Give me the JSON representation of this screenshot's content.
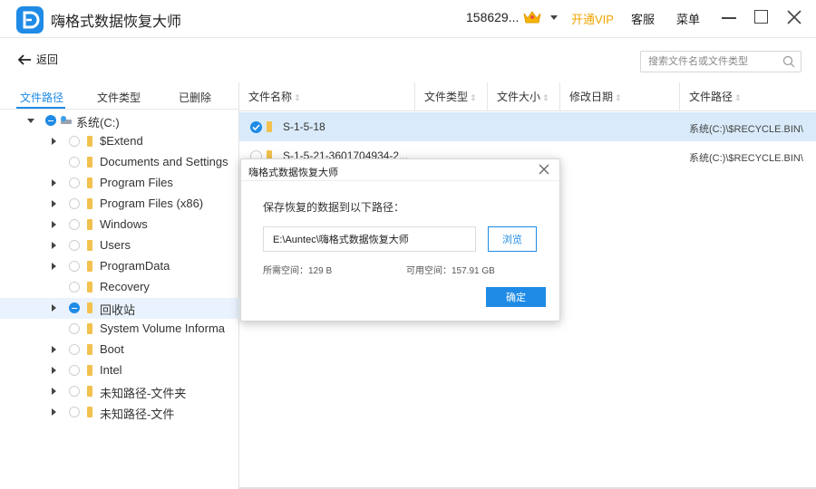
{
  "app": {
    "title": "嗨格式数据恢复大师",
    "user_id": "158629...",
    "vip_label": "开通VIP",
    "service_label": "客服",
    "menu_label": "菜单",
    "accent_color": "#1f8be6",
    "vip_color": "#f0a400"
  },
  "toolbar": {
    "back_label": "返回",
    "search_placeholder": "搜索文件名或文件类型"
  },
  "left_tabs": [
    {
      "label": "文件路径",
      "active": true
    },
    {
      "label": "文件类型",
      "active": false
    },
    {
      "label": "已删除",
      "active": false
    }
  ],
  "tree": {
    "root": {
      "label": "系统(C:)",
      "expanded": true,
      "check": "partial"
    },
    "items": [
      {
        "label": "$Extend",
        "has_children": true,
        "check": "off"
      },
      {
        "label": "Documents and Settings",
        "has_children": false,
        "check": "off"
      },
      {
        "label": "Program Files",
        "has_children": true,
        "check": "off"
      },
      {
        "label": "Program Files (x86)",
        "has_children": true,
        "check": "off"
      },
      {
        "label": "Windows",
        "has_children": true,
        "check": "off"
      },
      {
        "label": "Users",
        "has_children": true,
        "check": "off"
      },
      {
        "label": "ProgramData",
        "has_children": true,
        "check": "off"
      },
      {
        "label": "Recovery",
        "has_children": false,
        "check": "off"
      },
      {
        "label": "回收站",
        "has_children": true,
        "check": "partial",
        "selected": true
      },
      {
        "label": "System Volume Informa",
        "has_children": false,
        "check": "off"
      },
      {
        "label": "Boot",
        "has_children": true,
        "check": "off"
      },
      {
        "label": "Intel",
        "has_children": true,
        "check": "off"
      },
      {
        "label": "未知路径-文件夹",
        "has_children": true,
        "check": "off"
      },
      {
        "label": "未知路径-文件",
        "has_children": true,
        "check": "off"
      }
    ]
  },
  "columns": [
    "文件名称",
    "文件类型",
    "文件大小",
    "修改日期",
    "文件路径"
  ],
  "files": [
    {
      "name": "S-1-5-18",
      "path": "系统(C:)\\$RECYCLE.BIN\\",
      "checked": true
    },
    {
      "name": "S-1-5-21-3601704934-2...",
      "path": "系统(C:)\\$RECYCLE.BIN\\",
      "checked": false
    }
  ],
  "dialog": {
    "title": "嗨格式数据恢复大师",
    "prompt": "保存恢复的数据到以下路径：",
    "path_value": "E:\\Auntec\\嗨格式数据恢复大师",
    "browse_label": "浏览",
    "required_space": "所需空间：129 B",
    "available_space": "可用空间：157.91 GB",
    "ok_label": "确定"
  }
}
